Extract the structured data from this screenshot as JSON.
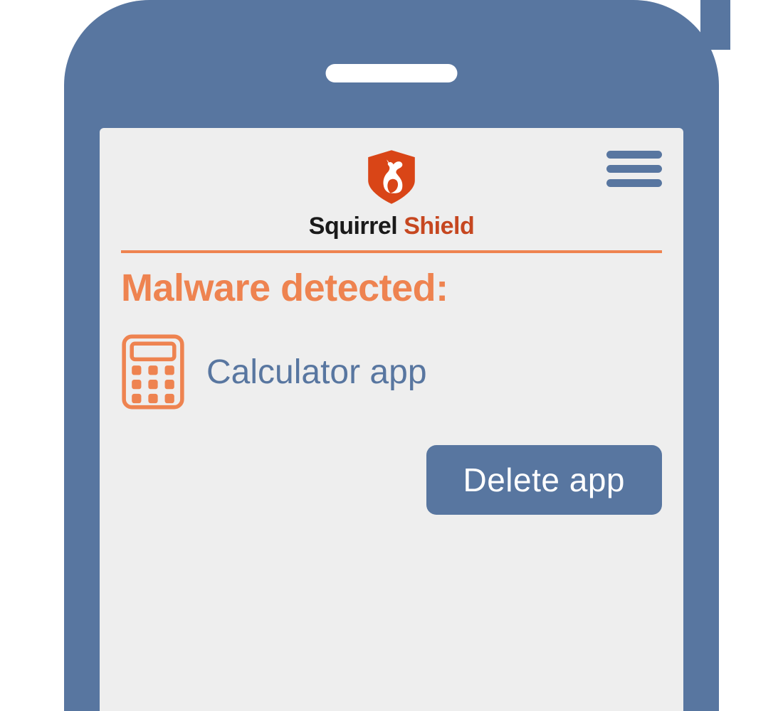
{
  "app": {
    "name_part1": "Squirrel",
    "name_part2": "Shield"
  },
  "alert": {
    "heading": "Malware detected:",
    "item_name": "Calculator app",
    "action_label": "Delete app"
  },
  "colors": {
    "frame": "#5876a0",
    "accent_orange": "#ee8350",
    "shield_red": "#d94517"
  }
}
